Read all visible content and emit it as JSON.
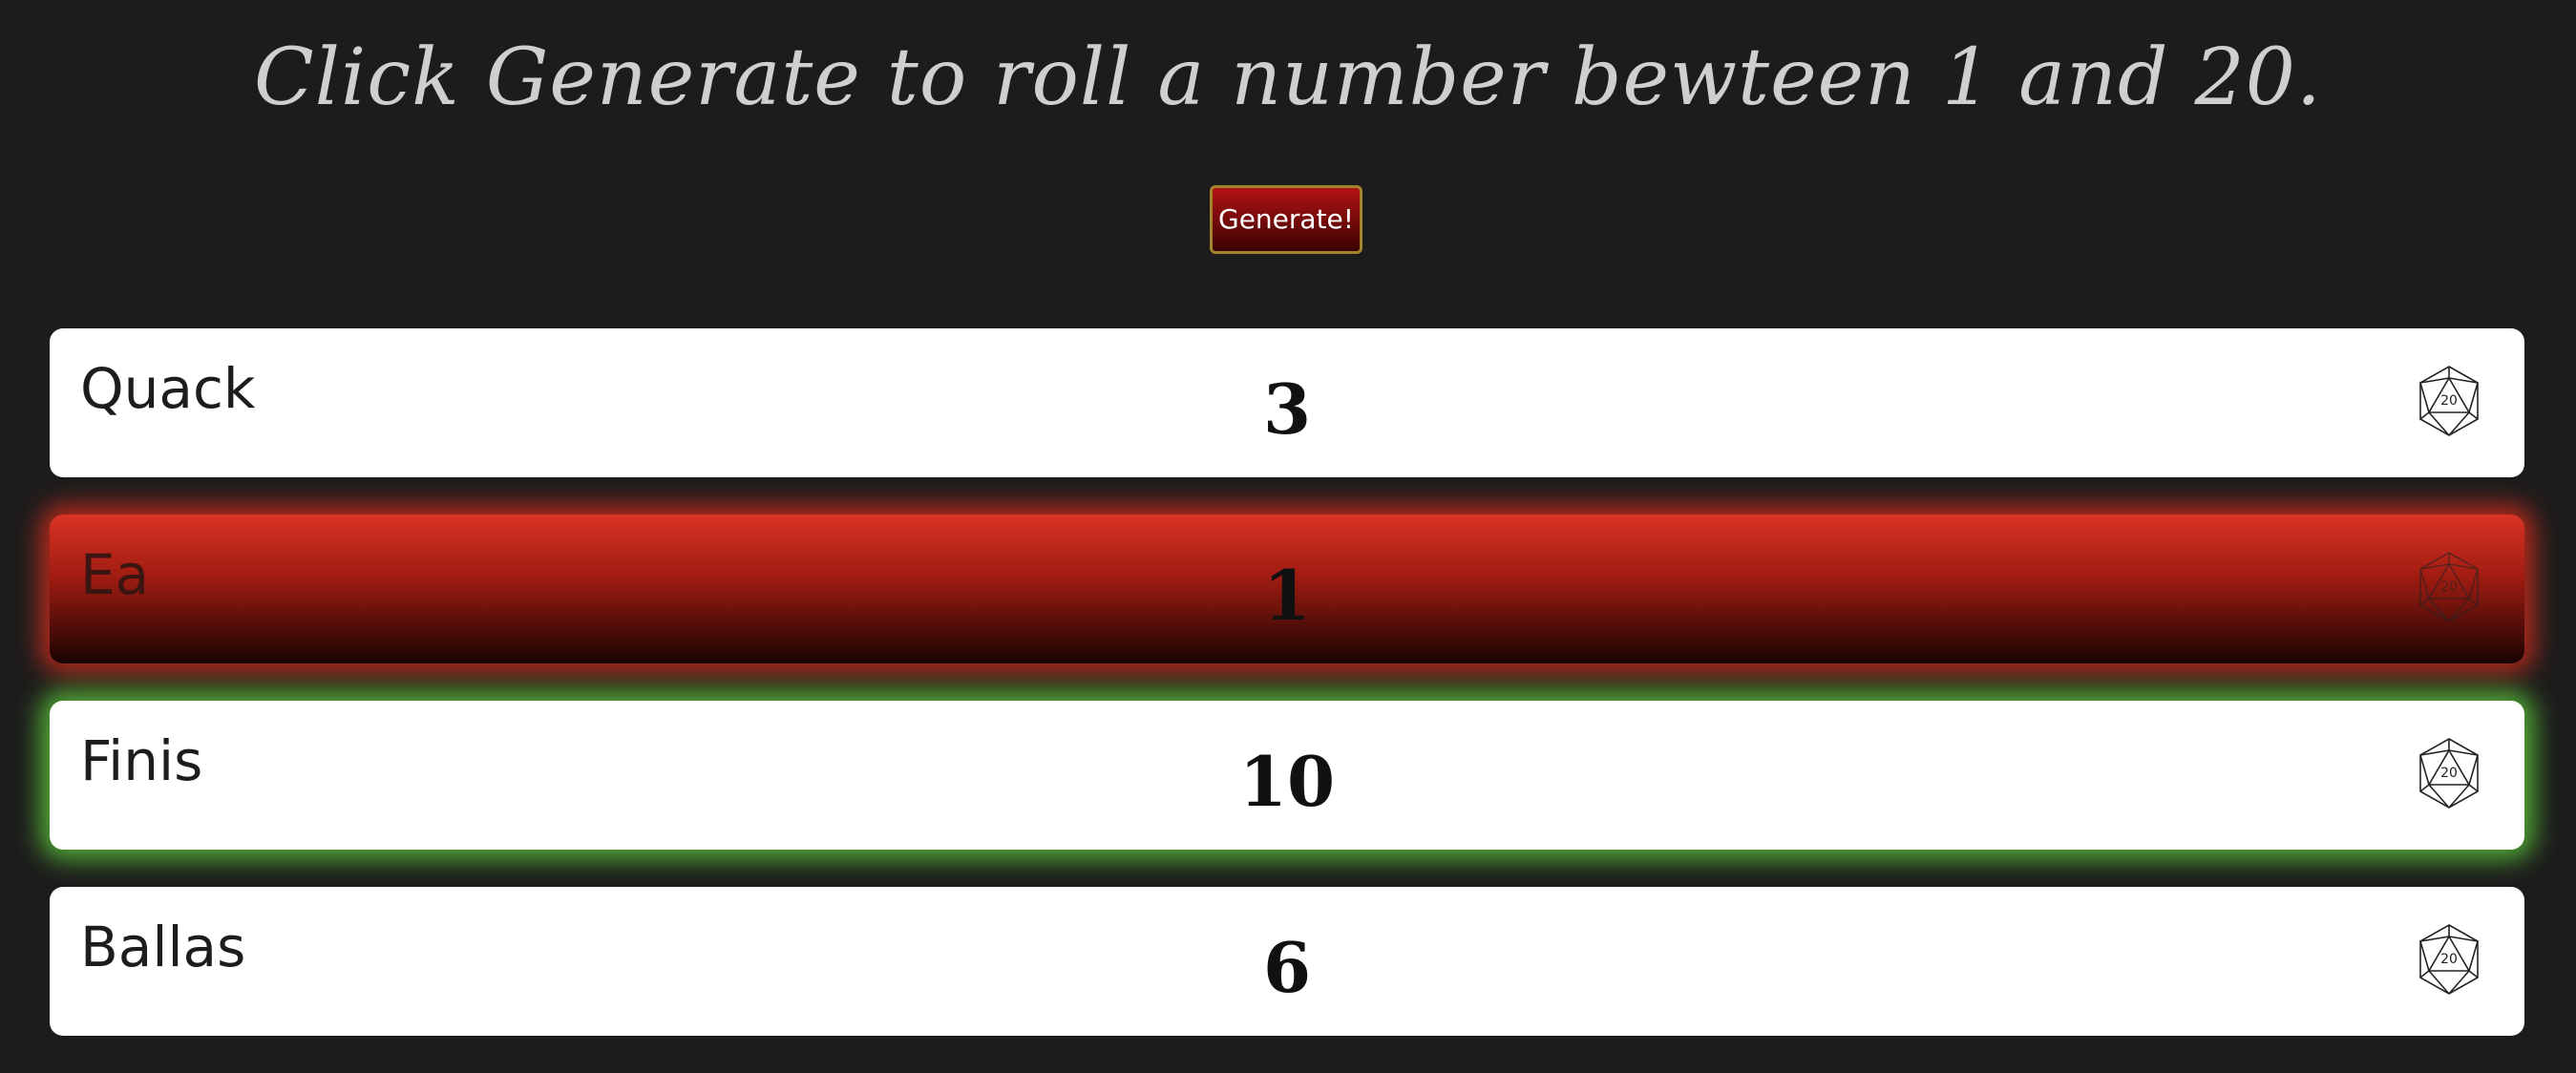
{
  "header": {
    "instruction": "Click Generate to roll a number bewteen 1 and 20."
  },
  "controls": {
    "generate_label": "Generate!"
  },
  "colors": {
    "background": "#1c1c1c",
    "button_red": "#b31313",
    "button_border": "#a3832d",
    "crit_fail_glow": "#eb301e",
    "crit_success_glow": "#5ec83c"
  },
  "rows": [
    {
      "name": "Quack",
      "roll": "3",
      "icon": "d20-icon",
      "state": "normal"
    },
    {
      "name": "Ea",
      "roll": "1",
      "icon": "d20-icon",
      "state": "critical-failure"
    },
    {
      "name": "Finis",
      "roll": "10",
      "icon": "d20-icon",
      "state": "highlighted"
    },
    {
      "name": "Ballas",
      "roll": "6",
      "icon": "d20-icon",
      "state": "normal"
    }
  ]
}
